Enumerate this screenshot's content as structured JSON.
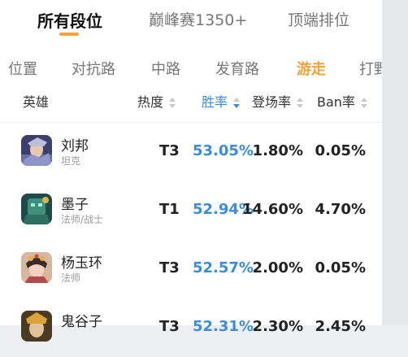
{
  "segment_tabs": [
    {
      "label": "所有段位",
      "active": true
    },
    {
      "label": "巅峰赛1350+",
      "active": false
    },
    {
      "label": "顶端排位",
      "active": false
    }
  ],
  "role_tabs": [
    {
      "label": "位置"
    },
    {
      "label": "对抗路"
    },
    {
      "label": "中路"
    },
    {
      "label": "发育路"
    },
    {
      "label": "游走",
      "active": true
    },
    {
      "label": "打野"
    }
  ],
  "table_header": {
    "hero": "英雄",
    "heat": "热度",
    "win_rate": "胜率",
    "pick_rate": "登场率",
    "ban_rate": "Ban率"
  },
  "rows": [
    {
      "name": "刘邦",
      "role": "坦克",
      "tier": "T3",
      "win": "53.05%",
      "pick": "1.80%",
      "ban": "0.05%",
      "avatar": "liu-bang-portrait"
    },
    {
      "name": "墨子",
      "role": "法师/战士",
      "tier": "T1",
      "win": "52.94%",
      "pick": "14.60%",
      "ban": "4.70%",
      "avatar": "mozi-portrait"
    },
    {
      "name": "杨玉环",
      "role": "法师",
      "tier": "T3",
      "win": "52.57%",
      "pick": "2.00%",
      "ban": "0.05%",
      "avatar": "yang-yuhuan-portrait"
    },
    {
      "name": "鬼谷子",
      "role": "",
      "tier": "T3",
      "win": "52.31%",
      "pick": "2.30%",
      "ban": "2.45%",
      "avatar": "guiguzi-portrait"
    }
  ],
  "colors": {
    "accent": "#f3a33a",
    "blue": "#3a8ddd"
  }
}
